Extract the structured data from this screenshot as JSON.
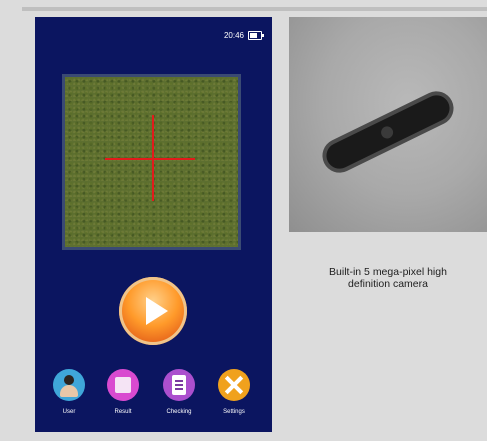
{
  "status": {
    "time": "20:46"
  },
  "nav": [
    {
      "label": "User"
    },
    {
      "label": "Result"
    },
    {
      "label": "Checking"
    },
    {
      "label": "Settings"
    }
  ],
  "caption": {
    "line1": "Built-in 5 mega-pixel high",
    "line2": "definition camera"
  },
  "colors": {
    "screen_bg": "#0b1560",
    "crosshair": "#e21b1b",
    "play": "#ff9a2a",
    "page_bg": "#dcdcdc"
  }
}
